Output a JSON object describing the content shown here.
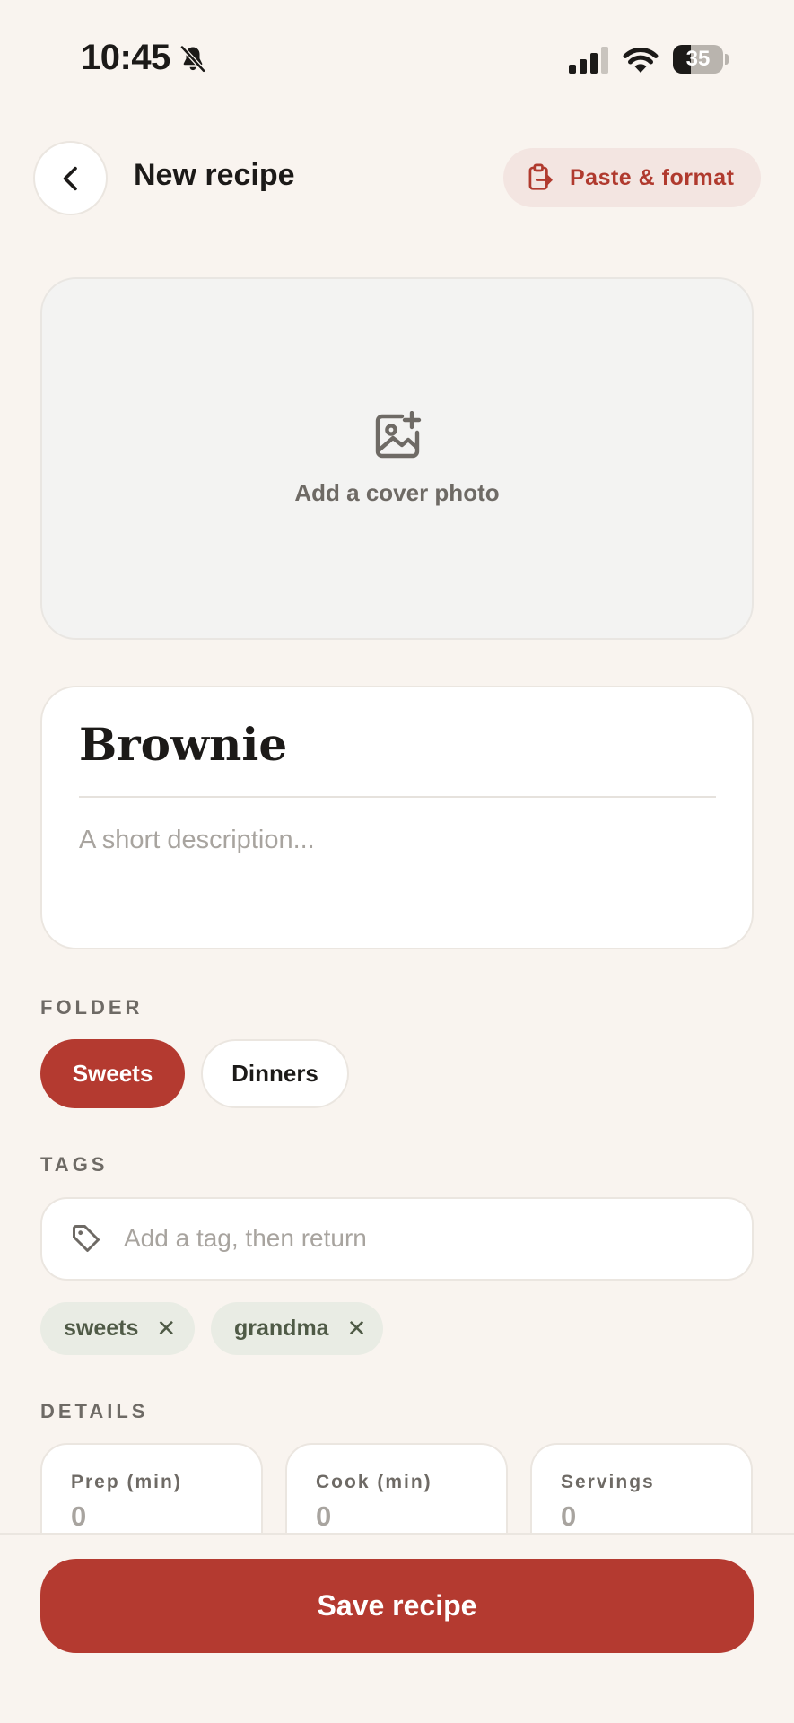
{
  "status_bar": {
    "time": "10:45",
    "battery_percent": "35",
    "battery_level": 0.35,
    "icons": [
      "bell-slash-icon",
      "signal-icon",
      "wifi-icon",
      "battery-icon"
    ]
  },
  "header": {
    "back_icon": "chevron-left-icon",
    "title": "New recipe",
    "paste_button": {
      "label": "Paste & format",
      "icon": "clipboard-icon"
    }
  },
  "cover": {
    "label": "Add a cover photo",
    "icon": "image-add-icon"
  },
  "recipe": {
    "title": "Brownie",
    "description_placeholder": "A short description..."
  },
  "folder": {
    "section_label": "FOLDER",
    "options": [
      {
        "label": "Sweets",
        "selected": true
      },
      {
        "label": "Dinners",
        "selected": false
      }
    ]
  },
  "tags": {
    "section_label": "TAGS",
    "placeholder": "Add a tag, then return",
    "icon": "tag-icon",
    "items": [
      {
        "label": "sweets",
        "remove": "✕"
      },
      {
        "label": "grandma",
        "remove": "✕"
      }
    ]
  },
  "details": {
    "section_label": "DETAILS",
    "fields": [
      {
        "label": "Prep (min)",
        "value": "0"
      },
      {
        "label": "Cook (min)",
        "value": "0"
      },
      {
        "label": "Servings",
        "value": "0"
      }
    ]
  },
  "actions": {
    "save_label": "Save recipe"
  },
  "colors": {
    "background": "#f9f4ef",
    "accent": "#b43a30",
    "accent_soft": "#f3e5e1",
    "tag_chip": "#e9ece4",
    "muted_text": "#6e6a65",
    "placeholder_text": "#a8a49f"
  }
}
